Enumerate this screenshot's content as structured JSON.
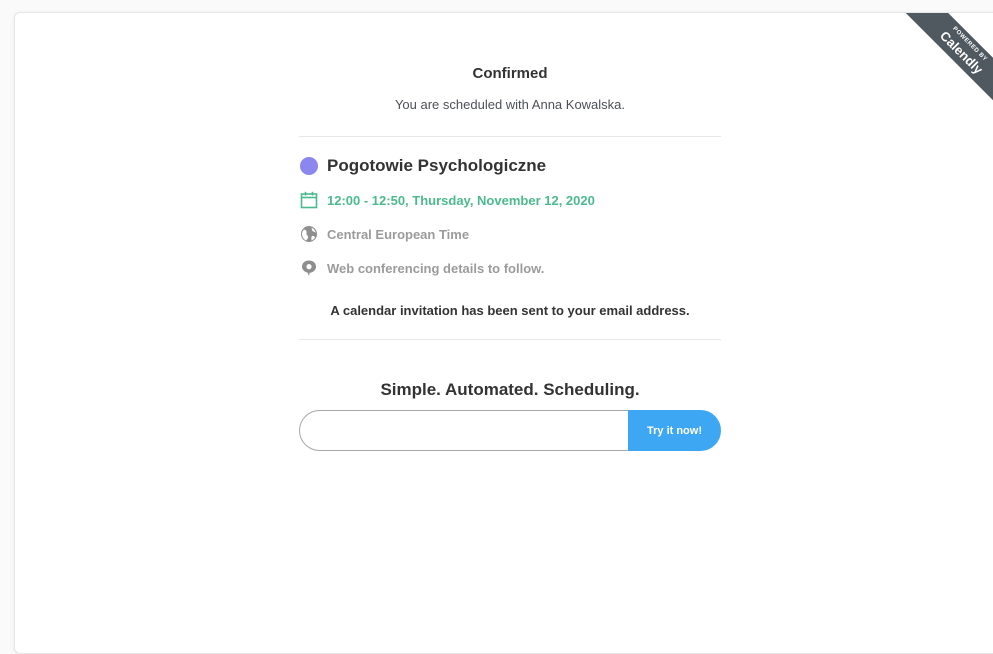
{
  "ribbon": {
    "powered_by": "POWERED BY",
    "brand": "Calendly"
  },
  "confirmation": {
    "title": "Confirmed",
    "subtitle": "You are scheduled with Anna Kowalska."
  },
  "event": {
    "name": "Pogotowie Psychologiczne",
    "color": "#8c87ee",
    "datetime": "12:00 - 12:50, Thursday, November 12, 2020",
    "timezone": "Central European Time",
    "location": "Web conferencing details to follow.",
    "icons": {
      "datetime": "calendar-icon",
      "timezone": "globe-icon",
      "location": "speech-bubble-icon"
    }
  },
  "invite_notice": "A calendar invitation has been sent to your email address.",
  "promo": {
    "tagline": "Simple. Automated. Scheduling.",
    "input_value": "",
    "button_label": "Try it now!"
  },
  "colors": {
    "accent_green": "#4cba8e",
    "button_blue": "#3ea7f3",
    "ribbon": "#505960"
  }
}
